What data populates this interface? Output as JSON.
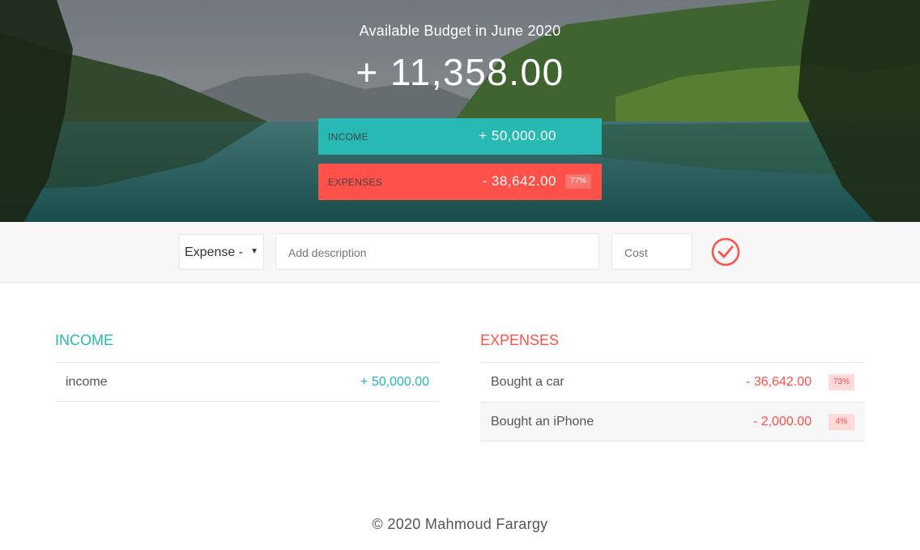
{
  "header": {
    "budget_title": "Available Budget in June 2020",
    "budget_value": "+ 11,358.00",
    "income_label": "Income",
    "income_value": "+ 50,000.00",
    "expenses_label": "Expenses",
    "expenses_value": "- 38,642.00",
    "expenses_percentage": "77%"
  },
  "add_form": {
    "type_selected": "Expense -",
    "description_placeholder": "Add description",
    "value_placeholder": "Cost",
    "submit_icon": "check-circle-icon"
  },
  "income_list": {
    "title": "Income",
    "items": [
      {
        "description": "income",
        "value": "+ 50,000.00"
      }
    ]
  },
  "expenses_list": {
    "title": "Expenses",
    "items": [
      {
        "description": "Bought a car",
        "value": "- 36,642.00",
        "percentage": "73%"
      },
      {
        "description": "Bought an iPhone",
        "value": "- 2,000.00",
        "percentage": "4%"
      }
    ]
  },
  "footer": {
    "text": "© 2020 Mahmoud Farargy"
  },
  "colors": {
    "income": "#28B9B5",
    "expense": "#FF5049",
    "percentage_bg": "#FFDAD9"
  }
}
